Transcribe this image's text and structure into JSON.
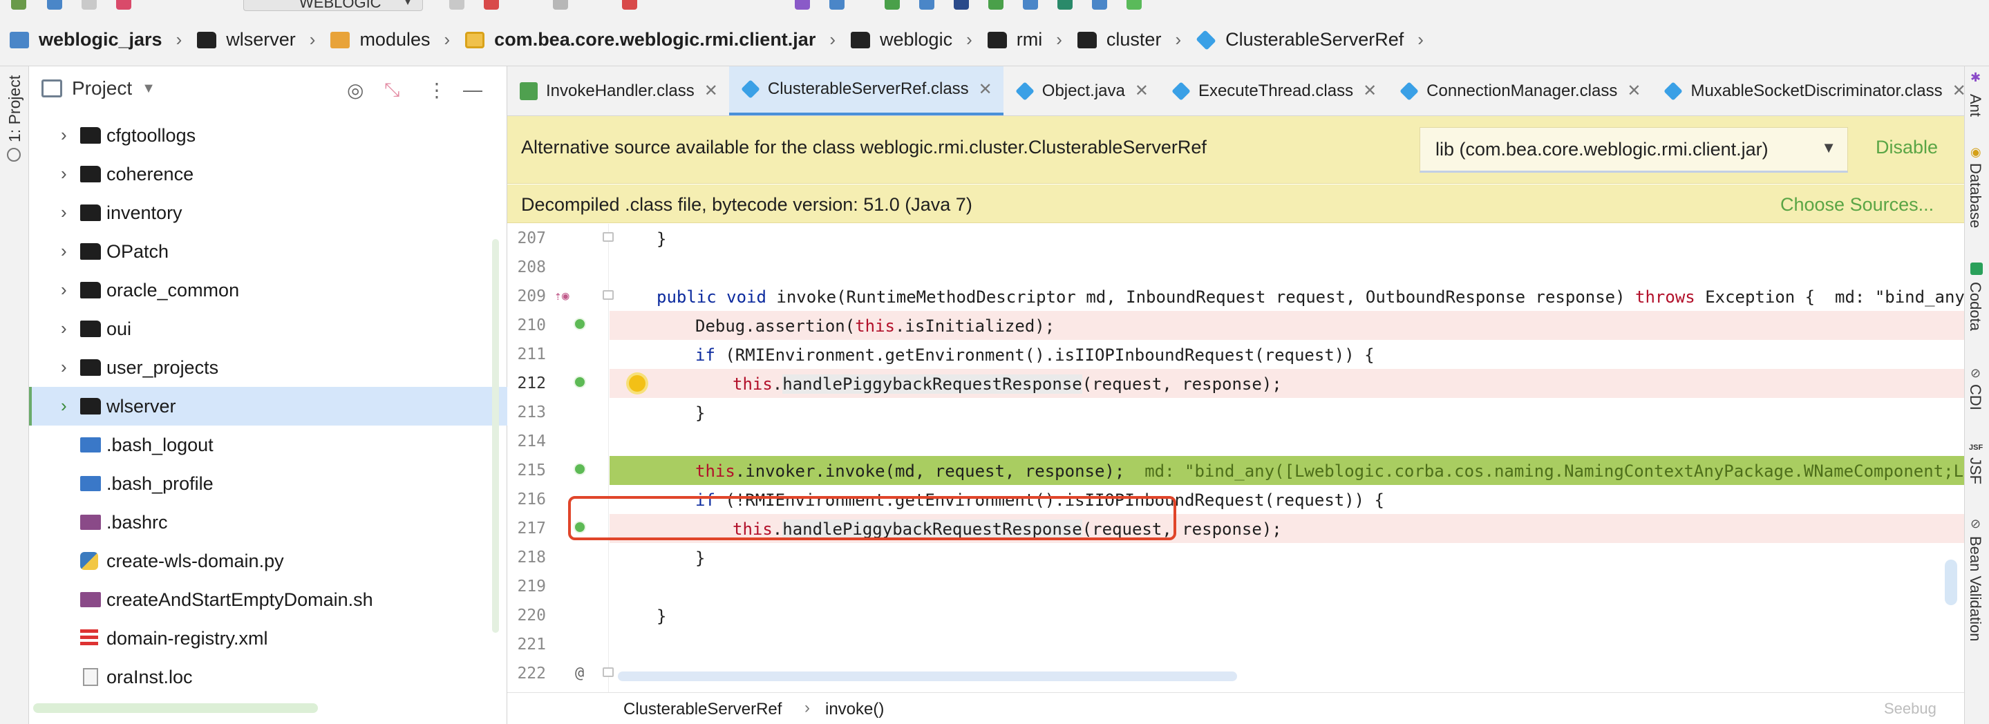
{
  "toolbar": {
    "run_config": "WEBLOGIC"
  },
  "breadcrumb": {
    "items": [
      {
        "label": "weblogic_jars",
        "icon": "project-icon"
      },
      {
        "label": "wlserver",
        "icon": "folder-icon"
      },
      {
        "label": "modules",
        "icon": "module-folder-icon"
      },
      {
        "label": "com.bea.core.weblogic.rmi.client.jar",
        "icon": "jar-icon"
      },
      {
        "label": "weblogic",
        "icon": "folder-icon"
      },
      {
        "label": "rmi",
        "icon": "folder-icon"
      },
      {
        "label": "cluster",
        "icon": "folder-icon"
      },
      {
        "label": "ClusterableServerRef",
        "icon": "class-icon"
      }
    ]
  },
  "left_stripe": {
    "project_label": "1: Project"
  },
  "project_panel": {
    "title": "Project",
    "tree": [
      {
        "label": "cfgtoollogs",
        "type": "folder"
      },
      {
        "label": "coherence",
        "type": "folder"
      },
      {
        "label": "inventory",
        "type": "folder"
      },
      {
        "label": "OPatch",
        "type": "folder"
      },
      {
        "label": "oracle_common",
        "type": "folder"
      },
      {
        "label": "oui",
        "type": "folder"
      },
      {
        "label": "user_projects",
        "type": "folder"
      },
      {
        "label": "wlserver",
        "type": "folder",
        "selected": true
      },
      {
        "label": ".bash_logout",
        "type": "shell"
      },
      {
        "label": ".bash_profile",
        "type": "shell"
      },
      {
        "label": ".bashrc",
        "type": "rc"
      },
      {
        "label": "create-wls-domain.py",
        "type": "python"
      },
      {
        "label": "createAndStartEmptyDomain.sh",
        "type": "rc"
      },
      {
        "label": "domain-registry.xml",
        "type": "xml"
      },
      {
        "label": "oraInst.loc",
        "type": "text"
      }
    ]
  },
  "tabs": [
    {
      "label": "InvokeHandler.class",
      "icon": "interface-icon",
      "active": false
    },
    {
      "label": "ClusterableServerRef.class",
      "icon": "class-icon",
      "active": true
    },
    {
      "label": "Object.java",
      "icon": "class-icon",
      "active": false
    },
    {
      "label": "ExecuteThread.class",
      "icon": "class-icon",
      "active": false
    },
    {
      "label": "ConnectionManager.class",
      "icon": "class-icon",
      "active": false
    },
    {
      "label": "MuxableSocketDiscriminator.class",
      "icon": "class-icon",
      "active": false
    }
  ],
  "tabs_more": "2",
  "banner": {
    "alt_source_msg": "Alternative source available for the class weblogic.rmi.cluster.ClusterableServerRef",
    "library_select": "lib (com.bea.core.weblogic.rmi.client.jar)",
    "disable_label": "Disable",
    "decompiled_msg": "Decompiled .class file, bytecode version: 51.0 (Java 7)",
    "choose_sources_label": "Choose Sources..."
  },
  "code": {
    "lines": [
      {
        "num": "207",
        "text": "}"
      },
      {
        "num": "208",
        "text": ""
      },
      {
        "num": "209",
        "text": "public void invoke(RuntimeMethodDescriptor md, InboundRequest request, OutboundResponse response) throws Exception {  md: \"bind_any([Lw"
      },
      {
        "num": "210",
        "text": "Debug.assertion(this.isInitialized);"
      },
      {
        "num": "211",
        "text": "if (RMIEnvironment.getEnvironment().isIIOPInboundRequest(request)) {"
      },
      {
        "num": "212",
        "text": "this.handlePiggybackRequestResponse(request, response);"
      },
      {
        "num": "213",
        "text": "}"
      },
      {
        "num": "214",
        "text": ""
      },
      {
        "num": "215",
        "text": "this.invoker.invoke(md, request, response);   md: \"bind_any([Lweblogic.corba.cos.naming.NamingContextAnyPackage.WNameComponent;Lorg."
      },
      {
        "num": "216",
        "text": "if (!RMIEnvironment.getEnvironment().isIIOPInboundRequest(request)) {"
      },
      {
        "num": "217",
        "text": "this.handlePiggybackRequestResponse(request, response);"
      },
      {
        "num": "218",
        "text": "}"
      },
      {
        "num": "219",
        "text": ""
      },
      {
        "num": "220",
        "text": "}"
      },
      {
        "num": "221",
        "text": ""
      },
      {
        "num": "222",
        "text": ""
      }
    ]
  },
  "status": {
    "class_crumb": "ClusterableServerRef",
    "method_crumb": "invoke()",
    "watermark": "Seebug"
  },
  "right_stripe": [
    "Ant",
    "Database",
    "Codota",
    "CDI",
    "JSF",
    "Bean Validation"
  ],
  "colors": {
    "accent": "#4a90d9",
    "banner": "#f5eeb2",
    "exec_line": "#a9cd61",
    "breakpoint_line": "#fbe8e6",
    "highlight_box": "#e0452a",
    "link_green": "#5aa545"
  }
}
